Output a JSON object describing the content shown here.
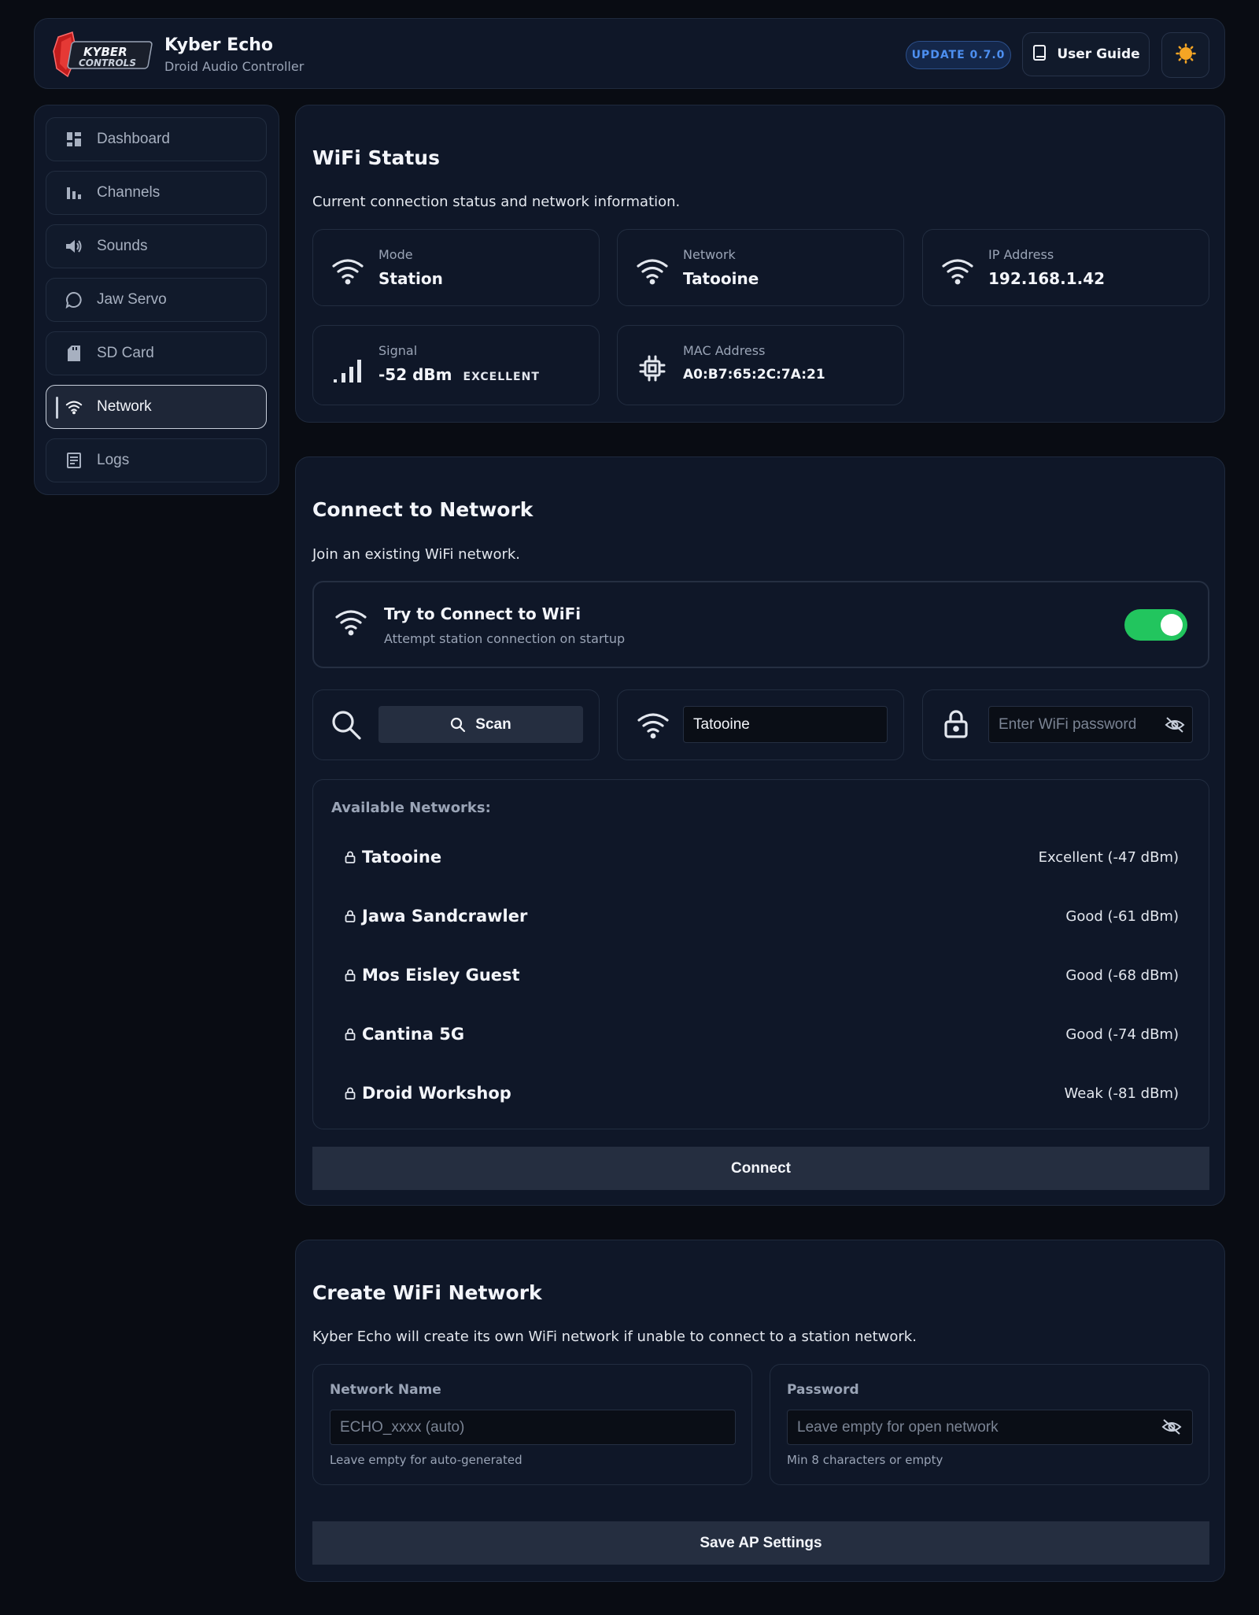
{
  "header": {
    "logo_text": "KYBER CONTROLS",
    "title": "Kyber Echo",
    "subtitle": "Droid Audio Controller",
    "update_badge": "UPDATE 0.7.0",
    "guide_label": "User Guide"
  },
  "sidebar": {
    "items": [
      {
        "label": "Dashboard",
        "icon": "dashboard-icon"
      },
      {
        "label": "Channels",
        "icon": "bars-icon"
      },
      {
        "label": "Sounds",
        "icon": "speaker-icon"
      },
      {
        "label": "Jaw Servo",
        "icon": "chat-bubble-icon"
      },
      {
        "label": "SD Card",
        "icon": "sd-card-icon"
      },
      {
        "label": "Network",
        "icon": "wifi-icon",
        "active": true
      },
      {
        "label": "Logs",
        "icon": "document-icon"
      }
    ]
  },
  "wifi_status": {
    "title": "WiFi Status",
    "description": "Current connection status and network information.",
    "mode": {
      "label": "Mode",
      "value": "Station"
    },
    "network": {
      "label": "Network",
      "value": "Tatooine"
    },
    "ip": {
      "label": "IP Address",
      "value": "192.168.1.42"
    },
    "signal": {
      "label": "Signal",
      "value": "-52 dBm",
      "quality": "EXCELLENT"
    },
    "mac": {
      "label": "MAC Address",
      "value": "A0:B7:65:2C:7A:21"
    }
  },
  "connect": {
    "title": "Connect to Network",
    "description": "Join an existing WiFi network.",
    "toggle_title": "Try to Connect to WiFi",
    "toggle_subtitle": "Attempt station connection on startup",
    "toggle_on": true,
    "scan_label": "Scan",
    "ssid_value": "Tatooine",
    "password_placeholder": "Enter WiFi password",
    "available_label": "Available Networks:",
    "networks": [
      {
        "name": "Tatooine",
        "strength": "Excellent (-47 dBm)"
      },
      {
        "name": "Jawa Sandcrawler",
        "strength": "Good (-61 dBm)"
      },
      {
        "name": "Mos Eisley Guest",
        "strength": "Good (-68 dBm)"
      },
      {
        "name": "Cantina 5G",
        "strength": "Good (-74 dBm)"
      },
      {
        "name": "Droid Workshop",
        "strength": "Weak (-81 dBm)"
      }
    ],
    "connect_label": "Connect"
  },
  "ap": {
    "title": "Create WiFi Network",
    "description": "Kyber Echo will create its own WiFi network if unable to connect to a station network.",
    "name_label": "Network Name",
    "name_placeholder": "ECHO_xxxx (auto)",
    "name_hint": "Leave empty for auto-generated",
    "password_label": "Password",
    "password_placeholder": "Leave empty for open network",
    "password_hint": "Min 8 characters or empty",
    "save_label": "Save AP Settings"
  },
  "colors": {
    "background": "#090c13",
    "panel": "#0f1728",
    "accent_green": "#22c55e",
    "accent_blue": "#4d8ff0"
  }
}
